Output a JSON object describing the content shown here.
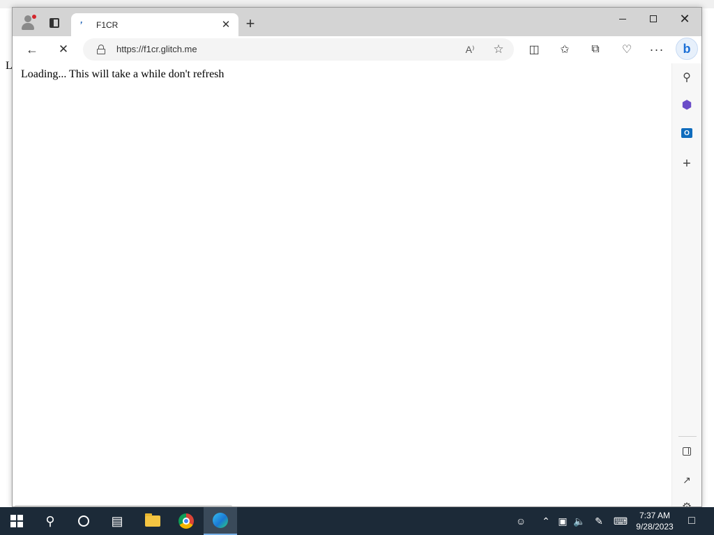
{
  "background_page": {
    "letter": "L"
  },
  "browser": {
    "tab": {
      "title": "F1CR",
      "favicon": "glitch-favicon"
    },
    "address_bar": {
      "url": "https://f1cr.glitch.me"
    },
    "content": {
      "text": "Loading... This will take a while don't refresh"
    },
    "toolbar_icons": [
      "read-aloud-icon",
      "favorite-star-icon",
      "split-screen-icon",
      "favorites-icon",
      "collections-icon",
      "browser-essentials-icon",
      "more-icon",
      "bing-chat-icon"
    ],
    "sidebar_icons": [
      "search-icon",
      "office-icon",
      "outlook-icon",
      "add-icon",
      "hide-sidebar-icon",
      "external-link-icon",
      "settings-icon"
    ]
  },
  "taskbar": {
    "clock": {
      "time": "7:37 AM",
      "date": "9/28/2023"
    },
    "pinned": [
      "start-icon",
      "search-icon",
      "cortana-icon",
      "task-view-icon",
      "file-explorer-icon",
      "chrome-icon",
      "edge-icon"
    ]
  },
  "colors": {
    "titlebar": "#d4d4d4",
    "taskbar": "#1c2a38",
    "bing_accent": "#1b6fd6"
  }
}
